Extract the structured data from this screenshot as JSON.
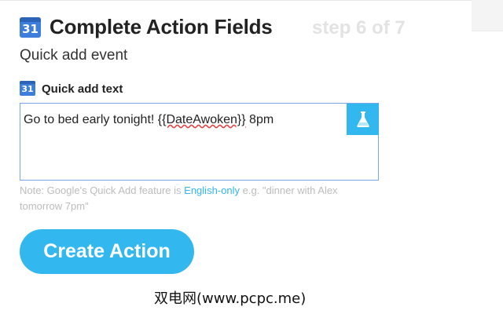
{
  "header": {
    "calendar_icon_text": "31",
    "title": "Complete Action Fields",
    "step": "step 6 of 7"
  },
  "action": {
    "name": "Quick add event"
  },
  "field": {
    "calendar_icon_text": "31",
    "label": "Quick add text",
    "value_prefix": "Go to bed early tonight! ",
    "value_ingredient": "{{DateAwoken}}",
    "value_suffix": " 8pm",
    "ingredient_button_icon": "flask-icon"
  },
  "note": {
    "text_before": "Note: Google's Quick Add feature is ",
    "link": "English-only",
    "text_after": " e.g. \"dinner with Alex tomorrow 7pm\""
  },
  "create_button": {
    "label": "Create Action"
  },
  "watermark": {
    "text": "双电网(www.pcpc.me)"
  },
  "colors": {
    "accent": "#33b7ef",
    "calendar_blue": "#3d7ddb",
    "muted_text": "#bcbcbc",
    "field_border": "#79a6e6"
  }
}
